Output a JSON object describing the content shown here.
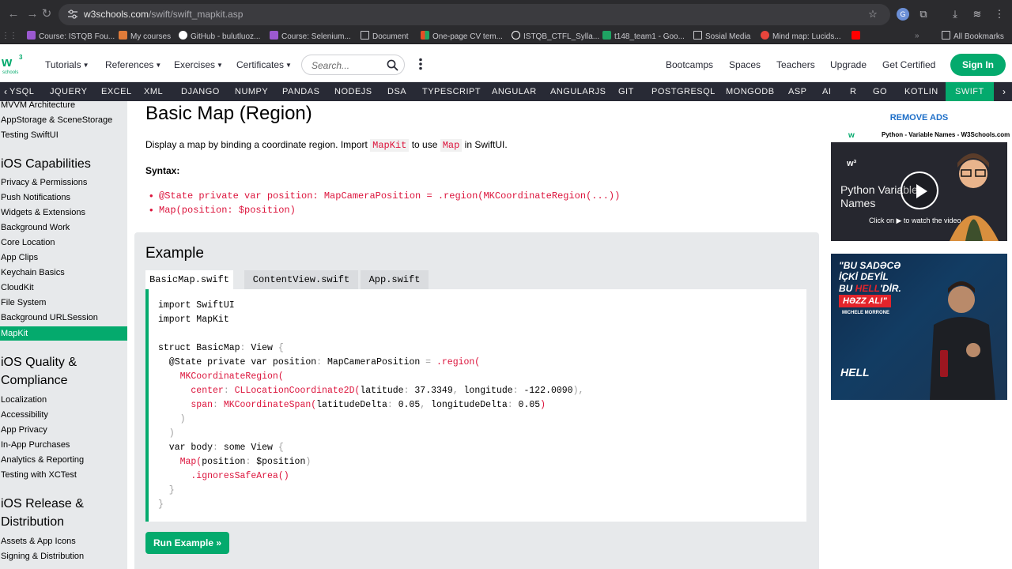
{
  "browser": {
    "url_host": "w3schools.com",
    "url_path": "/swift/swift_mapkit.asp",
    "bookmarks": [
      {
        "label": "Course: ISTQB Fou...",
        "color": "#9b59d0"
      },
      {
        "label": "My courses",
        "color": "#e07b39"
      },
      {
        "label": "GitHub - bulutluoz...",
        "color": "#ffffff"
      },
      {
        "label": "Course: Selenium...",
        "color": "#9b59d0"
      },
      {
        "label": "Document",
        "color": "#c9c9ce"
      },
      {
        "label": "One-page CV tem...",
        "color": "#e44d26"
      },
      {
        "label": "ISTQB_CTFL_Sylla...",
        "color": "#ffffff"
      },
      {
        "label": "t148_team1 - Goo...",
        "color": "#1fa463"
      },
      {
        "label": "Sosial Media",
        "color": "#c9c9ce"
      },
      {
        "label": "Mind map: Lucids...",
        "color": "#e8453c"
      },
      {
        "label": "",
        "color": "#ff0000"
      }
    ],
    "all_bookmarks": "All Bookmarks"
  },
  "header": {
    "menus": [
      "Tutorials",
      "References",
      "Exercises",
      "Certificates"
    ],
    "search_placeholder": "Search...",
    "right_links": [
      "Bootcamps",
      "Spaces",
      "Teachers",
      "Upgrade",
      "Get Certified"
    ],
    "sign_in": "Sign In",
    "brand_color": "#04aa6d"
  },
  "topics": [
    "YSQL",
    "JQUERY",
    "EXCEL",
    "XML",
    "DJANGO",
    "NUMPY",
    "PANDAS",
    "NODEJS",
    "DSA",
    "TYPESCRIPT",
    "ANGULAR",
    "ANGULARJS",
    "GIT",
    "POSTGRESQL",
    "MONGODB",
    "ASP",
    "AI",
    "R",
    "GO",
    "KOTLIN",
    "SWIFT"
  ],
  "sidebar": {
    "top_items": [
      "MVVM Architecture",
      "AppStorage & SceneStorage",
      "Testing SwiftUI"
    ],
    "section1": "iOS Capabilities",
    "section1_items": [
      "Privacy & Permissions",
      "Push Notifications",
      "Widgets & Extensions",
      "Background Work",
      "Core Location",
      "App Clips",
      "Keychain Basics",
      "CloudKit",
      "File System",
      "Background URLSession",
      "MapKit"
    ],
    "section2": "iOS Quality & Compliance",
    "section2_items": [
      "Localization",
      "Accessibility",
      "App Privacy",
      "In-App Purchases",
      "Analytics & Reporting",
      "Testing with XCTest"
    ],
    "section3": "iOS Release & Distribution",
    "section3_items": [
      "Assets & App Icons",
      "Signing & Distribution"
    ]
  },
  "main": {
    "title": "Basic Map (Region)",
    "intro_pre": "Display a map by binding a coordinate region. Import ",
    "intro_kw1": "MapKit",
    "intro_mid": " to use ",
    "intro_kw2": "Map",
    "intro_post": " in SwiftUI.",
    "syntax_label": "Syntax:",
    "syntax_items": [
      "@State private var position: MapCameraPosition = .region(MKCoordinateRegion(...))",
      "Map(position: $position)"
    ],
    "example_heading": "Example",
    "tabs": [
      "BasicMap.swift",
      "ContentView.swift",
      "App.swift"
    ],
    "run_button": "Run Example »",
    "code": {
      "l1": "import SwiftUI",
      "l2": "import MapKit",
      "l4a": "struct BasicMap",
      "l4b": ": ",
      "l4c": "View",
      "l4d": " {",
      "l5a": "  @State private var position",
      "l5b": ": ",
      "l5c": "MapCameraPosition",
      "l5d": " = ",
      "l5e": ".region(",
      "l6": "    MKCoordinateRegion(",
      "l7a": "      center",
      "l7b": ": ",
      "l7c": "CLLocationCoordinate2D(",
      "l7d": "latitude",
      "l7e": ": ",
      "l7f": "37.3349",
      "l7g": ", ",
      "l7h": "longitude",
      "l7i": ": ",
      "l7j": "-122.0090",
      "l7k": "),",
      "l8a": "      span",
      "l8b": ": ",
      "l8c": "MKCoordinateSpan(",
      "l8d": "latitudeDelta",
      "l8e": ": ",
      "l8f": "0.05",
      "l8g": ", ",
      "l8h": "longitudeDelta",
      "l8i": ": ",
      "l8j": "0.05",
      "l8k": ")",
      "l9": "    )",
      "l10": "  )",
      "l11a": "  var body",
      "l11b": ": ",
      "l11c": "some View",
      "l11d": " {",
      "l12a": "    Map(",
      "l12b": "position",
      "l12c": ": ",
      "l12d": "$position",
      "l12e": ")",
      "l13": "      .ignoresSafeArea()",
      "l14": "  }",
      "l15": "}"
    }
  },
  "ads": {
    "remove_ads": "REMOVE ADS",
    "video_title": "Python - Variable Names - W3Schools.com",
    "video_heading": "Python Variable Names",
    "video_caption": "Click on ▶ to watch the video",
    "banner_line1": "\"BU SADƏCƏ",
    "banner_line1b": "İÇKİ DEYİL",
    "banner_line2_pre": "BU ",
    "banner_line2_red": "HELL",
    "banner_line2_post": "'DİR.",
    "banner_cta": "HƏZZ AL!\"",
    "banner_name": "MICHELE MORRONE",
    "banner_brand": "HELL"
  }
}
